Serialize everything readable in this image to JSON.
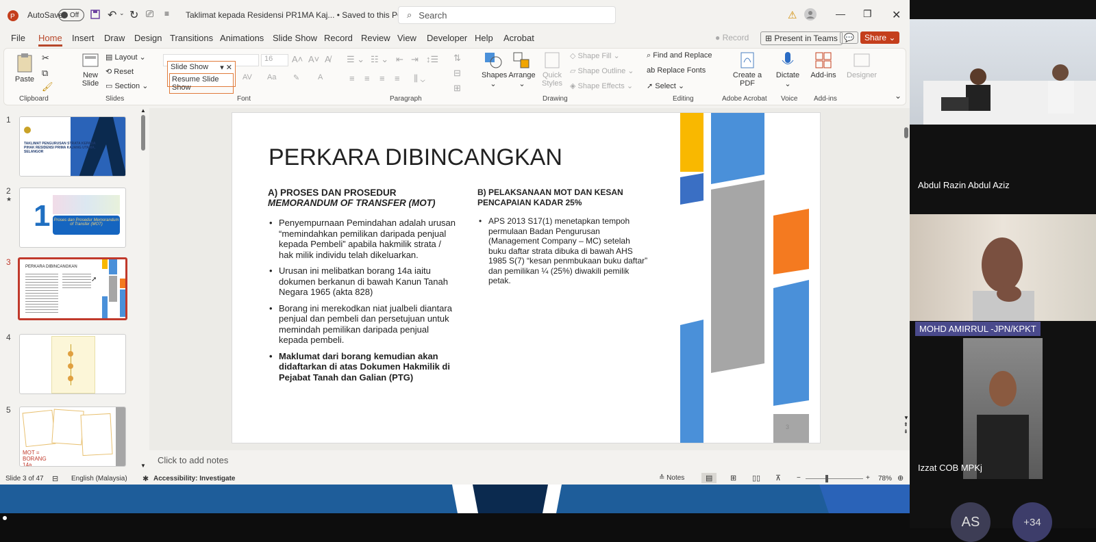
{
  "titlebar": {
    "autosave_label": "AutoSave",
    "autosave_state": "Off",
    "document_title": "Taklimat kepada Residensi PR1MA Kaj... • Saved to this PC",
    "search_placeholder": "Search"
  },
  "menu": [
    "File",
    "Home",
    "Insert",
    "Draw",
    "Design",
    "Transitions",
    "Animations",
    "Slide Show",
    "Record",
    "Review",
    "View",
    "Developer",
    "Help",
    "Acrobat"
  ],
  "menu_right": {
    "record": "Record",
    "present": "Present in Teams",
    "share": "Share"
  },
  "ribbon": {
    "clipboard": {
      "paste": "Paste",
      "label": "Clipboard"
    },
    "slides": {
      "new_slide": "New Slide",
      "layout": "Layout",
      "reset": "Reset",
      "section": "Section",
      "label": "Slides"
    },
    "font": {
      "font_name": "16",
      "label": "Font"
    },
    "slideshow_popup": {
      "item1": "Slide Show",
      "item2": "Resume Slide Show"
    },
    "paragraph": {
      "label": "Paragraph"
    },
    "drawing": {
      "shapes": "Shapes",
      "arrange": "Arrange",
      "quick_styles": "Quick Styles",
      "shape_fill": "Shape Fill",
      "shape_outline": "Shape Outline",
      "shape_effects": "Shape Effects",
      "label": "Drawing"
    },
    "editing": {
      "find": "Find and Replace",
      "replace_fonts": "Replace Fonts",
      "select": "Select",
      "label": "Editing"
    },
    "acrobat": {
      "create_pdf": "Create a PDF",
      "label": "Adobe Acrobat"
    },
    "voice": {
      "dictate": "Dictate",
      "label": "Voice"
    },
    "addins": {
      "addins": "Add-ins",
      "designer": "Designer",
      "label": "Add-ins"
    }
  },
  "thumbnails": [
    {
      "num": "1",
      "text": "TAKLIMAT PENGURUSAN STRATA KEPADA PIHAK RESIDENSI PRIMA KAJANG UTAMA, SELANGOR"
    },
    {
      "num": "2",
      "text": "Proses dan Prosedur Memorandum of Transfer (MOT)"
    },
    {
      "num": "3",
      "text": "PERKARA DIBINCANGKAN"
    },
    {
      "num": "4",
      "text": ""
    },
    {
      "num": "5",
      "text": "MOT = BORANG 14a"
    }
  ],
  "slide": {
    "title": "PERKARA DIBINCANGKAN",
    "left_heading_a": "A) PROSES DAN PROSEDUR",
    "left_heading_b": "MEMORANDUM OF TRANSFER (MOT)",
    "left_bullets": [
      "Penyempurnaan Pemindahan adalah urusan “memindahkan pemilikan daripada penjual kepada Pembeli” apabila hakmilik strata / hak milik individu telah dikeluarkan.",
      "Urusan ini melibatkan borang 14a iaitu dokumen berkanun di bawah Kanun Tanah Negara 1965 (akta 828)",
      "Borang ini merekodkan niat jualbeli diantara penjual dan pembeli dan persetujuan untuk memindah pemilikan daripada penjual kepada pembeli.",
      "Maklumat dari borang kemudian akan didaftarkan di atas Dokumen Hakmilik di Pejabat Tanah dan Galian (PTG)"
    ],
    "right_heading": "B) PELAKSANAAN MOT DAN KESAN PENCAPAIAN KADAR 25%",
    "right_bullet": "APS 2013 S17(1) menetapkan tempoh permulaan Badan Pengurusan (Management Company – MC) setelah buku daftar strata dibuka di bawah AHS 1985 S(7) “kesan penmbukaan buku daftar” dan pemilikan ¼ (25%) diwakili pemilik petak.",
    "page_number": "3"
  },
  "notes_placeholder": "Click to add notes",
  "status": {
    "slide_count": "Slide 3 of 47",
    "language": "English (Malaysia)",
    "accessibility": "Accessibility: Investigate",
    "notes": "Notes",
    "zoom": "78%"
  },
  "participants": [
    {
      "name": "Abdul Razin Abdul Aziz"
    },
    {
      "name": "MOHD AMIRRUL -JPN/KPKT"
    },
    {
      "name": "Izzat COB MPKj"
    },
    {
      "initials": "AS"
    },
    {
      "more": "+34"
    }
  ],
  "colors": {
    "accent": "#b7472a",
    "slide_yellow": "#f9b800",
    "slide_blue": "#4a90d9",
    "slide_gray": "#a6a6a6",
    "slide_orange": "#f47a20",
    "taskbar_blue": "#1e5d9a"
  }
}
